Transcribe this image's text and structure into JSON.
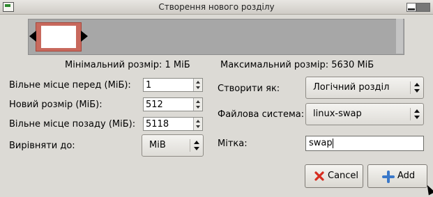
{
  "window": {
    "title": "Створення нового розділу"
  },
  "partition_bar": {},
  "info": {
    "min_size": "Мінімальний розмір: 1 МіБ",
    "max_size": "Максимальний розмір: 5630 МіБ"
  },
  "fields": {
    "free_before_label": "Вільне місце перед (МіБ):",
    "free_before_value": "1",
    "new_size_label": "Новий розмір (МіБ):",
    "new_size_value": "512",
    "free_after_label": "Вільне місце позаду (МіБ):",
    "free_after_value": "5118",
    "align_label": "Вирівняти до:",
    "align_value": "MiB",
    "create_as_label": "Створити як:",
    "create_as_value": "Логічний розділ",
    "filesystem_label": "Файлова система:",
    "filesystem_value": "linux-swap",
    "label_label": "Мітка:",
    "label_value": "swap"
  },
  "buttons": {
    "cancel_label": "Cancel",
    "add_label": "Add"
  },
  "colors": {
    "partition_fill": "#c8695d",
    "bar_gray": "#a7a7a7",
    "cancel_icon": "#d62d20",
    "add_icon": "#3a78c9"
  },
  "icons": {
    "cancel": "x-icon",
    "add": "plus-icon"
  }
}
